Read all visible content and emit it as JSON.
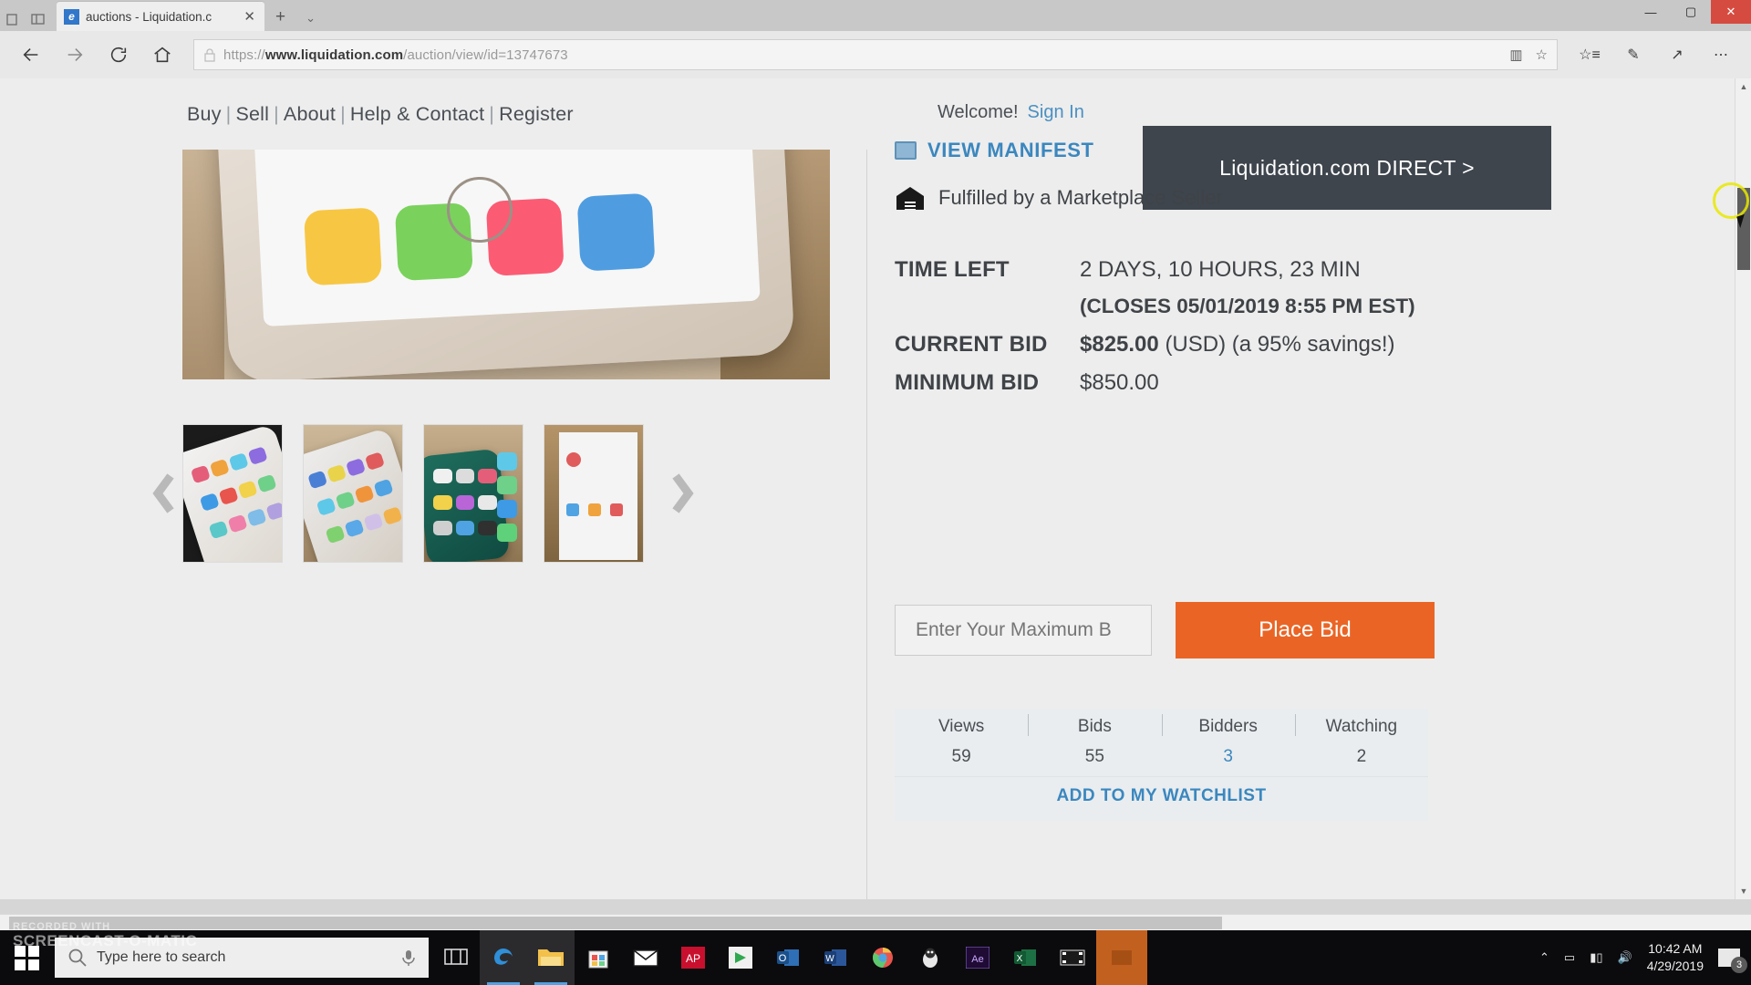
{
  "browser": {
    "tab": {
      "title": "auctions - Liquidation.c",
      "favicon": "e",
      "close": "✕"
    },
    "new_tab": "+",
    "tab_menu": "⌄",
    "window_controls": {
      "minimize": "—",
      "maximize": "▢",
      "close": "✕"
    },
    "url": {
      "scheme": "https://",
      "host": "www.liquidation.com",
      "path": "/auction/view/id=13747673"
    },
    "nav": {
      "back": "←",
      "forward": "→",
      "refresh": "⟳",
      "home": "⌂"
    },
    "toolbar_right": {
      "reading_view": "▥",
      "favorite": "☆",
      "favorites_hub": "☆≡",
      "notes": "✎",
      "share": "↗",
      "more": "⋯"
    }
  },
  "site": {
    "nav_items": [
      "Buy",
      "Sell",
      "About",
      "Help & Contact",
      "Register"
    ],
    "nav_separator": "|",
    "welcome_text": "Welcome!",
    "sign_in": "Sign In",
    "direct_banner": "Liquidation.com DIRECT >"
  },
  "gallery": {
    "prev_arrow": "‹",
    "next_arrow": "›",
    "thumbnails": [
      "iphone-thumb-1",
      "iphone-thumb-2",
      "iphone-thumb-3",
      "iphone-thumb-4"
    ]
  },
  "detail": {
    "view_manifest": "VIEW MANIFEST",
    "fulfilled_text": "Fulfilled by a Marketplace Seller",
    "time_left_label": "TIME LEFT",
    "time_left_value": "2 DAYS, 10 HOURS, 23 MIN",
    "closes_text": "(CLOSES 05/01/2019 8:55 PM EST)",
    "current_bid_label": "CURRENT BID",
    "current_bid_amount": "$825.00",
    "current_bid_suffix": "(USD) (a 95% savings!)",
    "minimum_bid_label": "MINIMUM BID",
    "minimum_bid_value": "$850.00",
    "bid_input_placeholder": "Enter Your Maximum B",
    "bid_input_value": "",
    "place_bid_label": "Place Bid",
    "stats_headers": [
      "Views",
      "Bids",
      "Bidders",
      "Watching"
    ],
    "stats_values": [
      "59",
      "55",
      "3",
      "2"
    ],
    "watchlist_label": "ADD TO MY WATCHLIST"
  },
  "colors": {
    "accent_orange": "#ea6525",
    "time_left_orange": "#eb6324",
    "link_blue": "#3b87bf",
    "banner_dark": "#3e454d"
  },
  "taskbar": {
    "search_placeholder": "Type here to search",
    "apps": [
      "task-view",
      "edge",
      "file-explorer",
      "microsoft-store",
      "mail",
      "ap-news",
      "green-app",
      "outlook",
      "word",
      "chrome",
      "tux-app",
      "after-effects",
      "excel",
      "movie-maker",
      "orange-app"
    ],
    "clock_time": "10:42 AM",
    "clock_date": "4/29/2019",
    "notification_count": "3"
  },
  "watermark": {
    "line1": "Recorded with",
    "line2": "Screencast-O-Matic"
  },
  "ghost_overlay": "direct-preview"
}
